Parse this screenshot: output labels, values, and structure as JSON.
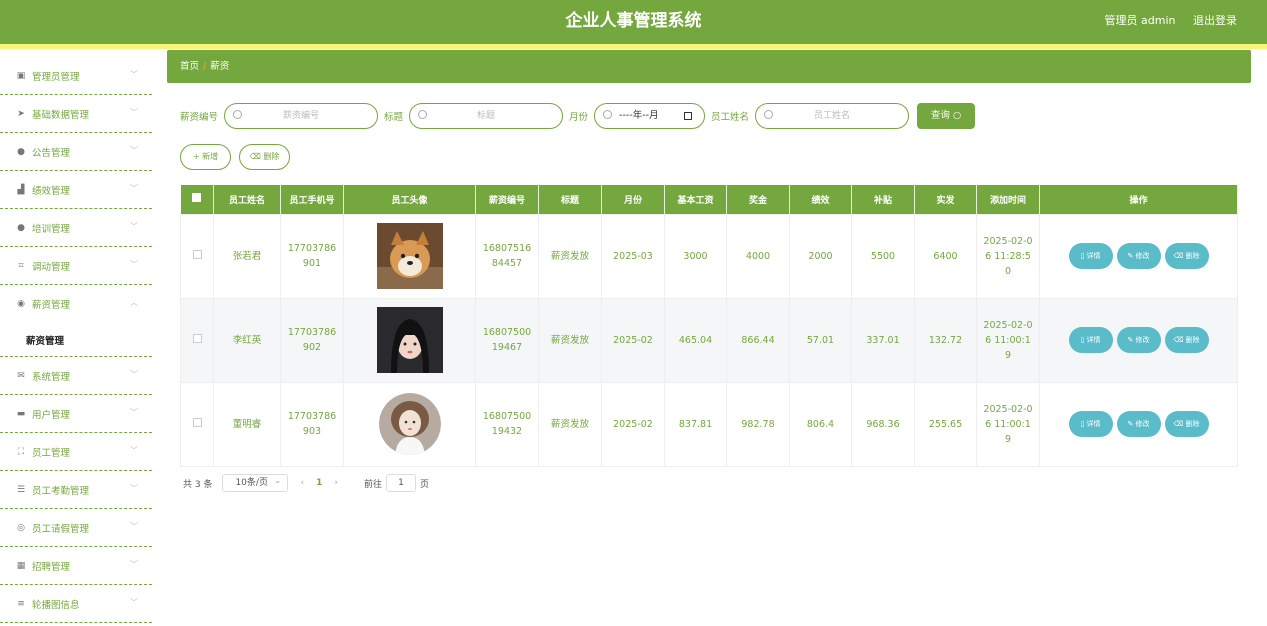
{
  "header": {
    "title": "企业人事管理系统",
    "user_label": "管理员 admin",
    "logout_label": "退出登录"
  },
  "sidebar": {
    "items": [
      {
        "label": "管理员管理",
        "icon": "clipboard-icon"
      },
      {
        "label": "基础数据管理",
        "icon": "send-icon"
      },
      {
        "label": "公告管理",
        "icon": "user-icon"
      },
      {
        "label": "绩效管理",
        "icon": "chart-icon"
      },
      {
        "label": "培训管理",
        "icon": "user-icon"
      },
      {
        "label": "调动管理",
        "icon": "crop-icon"
      },
      {
        "label": "薪资管理",
        "icon": "coin-icon",
        "expanded": true,
        "children": [
          "薪资管理"
        ]
      },
      {
        "label": "系统管理",
        "icon": "mail-icon"
      },
      {
        "label": "用户管理",
        "icon": "ticket-icon"
      },
      {
        "label": "员工管理",
        "icon": "fullscreen-icon"
      },
      {
        "label": "员工考勤管理",
        "icon": "sliders-icon"
      },
      {
        "label": "员工请假管理",
        "icon": "globe-icon"
      },
      {
        "label": "招聘管理",
        "icon": "grid-icon"
      },
      {
        "label": "轮播图信息",
        "icon": "menu-icon"
      }
    ]
  },
  "breadcrumb": {
    "home": "首页",
    "separator": "/",
    "current": "薪资"
  },
  "search": {
    "salary_no_label": "薪资编号",
    "salary_no_placeholder": "薪资编号",
    "title_label": "标题",
    "title_placeholder": "标题",
    "month_label": "月份",
    "month_value": "----年--月",
    "name_label": "员工姓名",
    "name_placeholder": "员工姓名",
    "query_button": "查询"
  },
  "actions": {
    "add": "+ 新增",
    "delete": "删除"
  },
  "table": {
    "headers": [
      "员工姓名",
      "员工手机号",
      "员工头像",
      "薪资编号",
      "标题",
      "月份",
      "基本工资",
      "奖金",
      "绩效",
      "补贴",
      "实发",
      "添加时间",
      "操作"
    ],
    "rows": [
      {
        "name": "张若君",
        "phone": "17703786901",
        "salary_no": "1680751684457",
        "title": "薪资发放",
        "month": "2025-03",
        "base": "3000",
        "bonus": "4000",
        "perf": "2000",
        "subsidy": "5500",
        "actual": "6400",
        "added": "2025-02-06 11:28:50"
      },
      {
        "name": "李红英",
        "phone": "17703786902",
        "salary_no": "1680750019467",
        "title": "薪资发放",
        "month": "2025-02",
        "base": "465.04",
        "bonus": "866.44",
        "perf": "57.01",
        "subsidy": "337.01",
        "actual": "132.72",
        "added": "2025-02-06 11:00:19"
      },
      {
        "name": "董明睿",
        "phone": "17703786903",
        "salary_no": "1680750019432",
        "title": "薪资发放",
        "month": "2025-02",
        "base": "837.81",
        "bonus": "982.78",
        "perf": "806.4",
        "subsidy": "968.36",
        "actual": "255.65",
        "added": "2025-02-06 11:00:19"
      }
    ],
    "op_labels": {
      "detail": "详情",
      "edit": "修改",
      "delete": "删除"
    }
  },
  "pagination": {
    "total": "共 3 条",
    "page_size": "10条/页",
    "current": "1",
    "goto_label": "前往",
    "goto_value": "1",
    "page_suffix": "页"
  },
  "colors": {
    "primary": "#75a73f",
    "accent_stripe": "#f5f57a",
    "op_button": "#5abcc9"
  }
}
